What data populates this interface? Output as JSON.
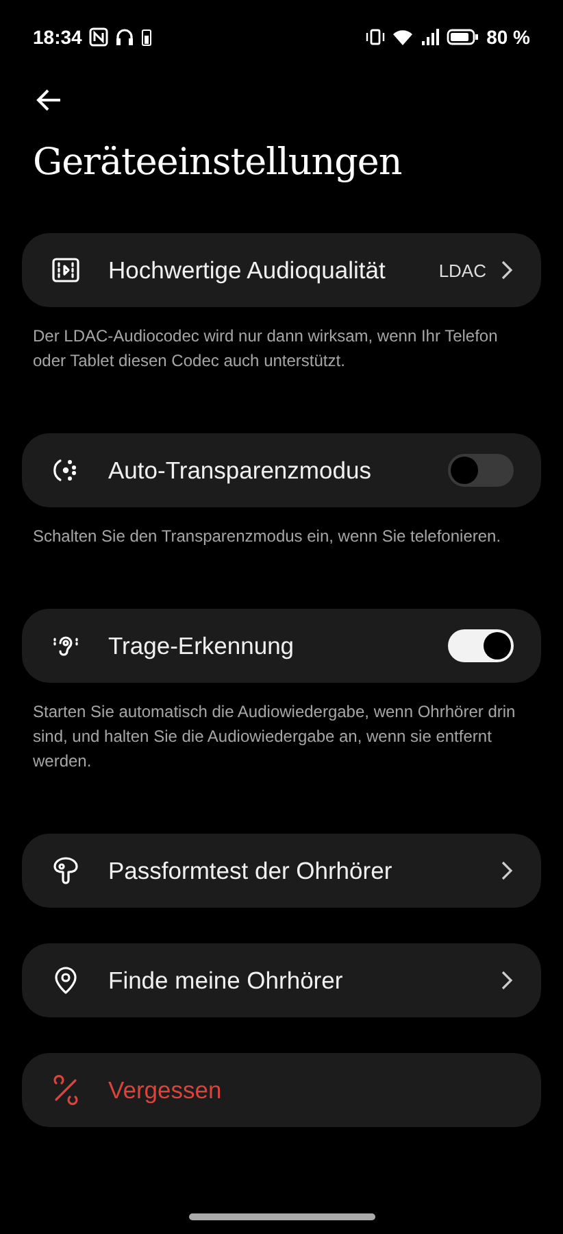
{
  "status_bar": {
    "time": "18:34",
    "battery": "80 %"
  },
  "title": "Geräteeinstellungen",
  "items": [
    {
      "kind": "nav",
      "label": "Hochwertige Audioqualität",
      "value": "LDAC",
      "description": "Der LDAC-Audiocodec wird nur dann wirksam, wenn Ihr Telefon oder Tablet diesen Codec auch unterstützt."
    },
    {
      "kind": "toggle",
      "label": "Auto-Transparenzmodus",
      "on": false,
      "description": "Schalten Sie den Transparenzmodus ein, wenn Sie telefonieren."
    },
    {
      "kind": "toggle",
      "label": "Trage-Erkennung",
      "on": true,
      "description": "Starten Sie automatisch die Audiowiedergabe, wenn Ohrhörer drin sind, und halten Sie die Audiowiedergabe an, wenn sie entfernt werden."
    },
    {
      "kind": "nav",
      "label": "Passformtest der Ohrhörer"
    },
    {
      "kind": "nav",
      "label": "Finde meine Ohrhörer"
    },
    {
      "kind": "danger",
      "label": "Vergessen"
    }
  ]
}
